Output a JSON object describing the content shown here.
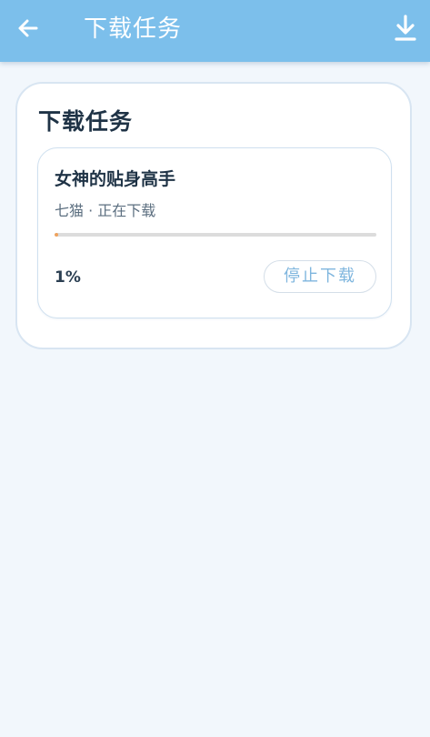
{
  "app_bar": {
    "title": "下载任务",
    "back_icon": "arrow-left-icon",
    "download_icon": "download-icon",
    "background": "#7cbfeb"
  },
  "panel": {
    "title": "下载任务"
  },
  "tasks": [
    {
      "name": "女神的贴身高手",
      "meta": "七猫 · 正在下载",
      "progress": 0.01,
      "percent_label": "1%",
      "stop_label": "停止下载",
      "progress_color": "#f0a25c"
    }
  ]
}
